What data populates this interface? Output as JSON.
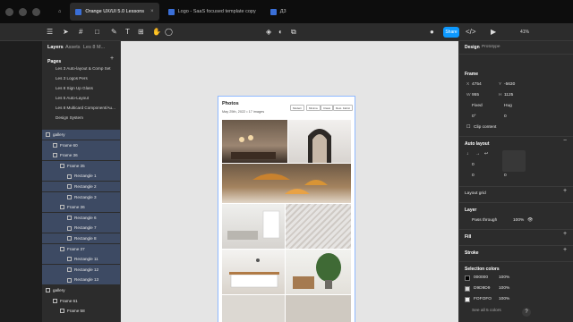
{
  "tabs": [
    {
      "label": "Orange UX/UI 5.0 Lessons",
      "active": true
    },
    {
      "label": "Logo - SaaS focused template copy",
      "active": false
    },
    {
      "label": "Д3",
      "active": false
    }
  ],
  "toolbar": {
    "share_label": "Share",
    "zoom": "41%"
  },
  "left_panel": {
    "tabs": [
      "Layers",
      "Assets",
      "Les 8 M..."
    ],
    "pages_header": "Pages",
    "pages": [
      "Les 3 Auto-layout & Comp Set",
      "Les 3 Logos Pers",
      "Les 8 Sign Up Glass",
      "Les 5 Auto-Layout",
      "Les 8 Multicard Component/Au...",
      "Design System"
    ],
    "layers": [
      {
        "label": "gallery",
        "indent": 0,
        "selected": true
      },
      {
        "label": "Frame 60",
        "indent": 1,
        "selected": true
      },
      {
        "label": "Frame 36",
        "indent": 1,
        "selected": true
      },
      {
        "label": "Frame 35",
        "indent": 2,
        "selected": true
      },
      {
        "label": "Rectangle 1",
        "indent": 3,
        "selected": true
      },
      {
        "label": "Rectangle 2",
        "indent": 3,
        "selected": true
      },
      {
        "label": "Rectangle 3",
        "indent": 3,
        "selected": true
      },
      {
        "label": "Frame 36",
        "indent": 2,
        "selected": true
      },
      {
        "label": "Rectangle 6",
        "indent": 3,
        "selected": true
      },
      {
        "label": "Rectangle 7",
        "indent": 3,
        "selected": true
      },
      {
        "label": "Rectangle 8",
        "indent": 3,
        "selected": true
      },
      {
        "label": "Frame 37",
        "indent": 2,
        "selected": true
      },
      {
        "label": "Rectangle 11",
        "indent": 3,
        "selected": true
      },
      {
        "label": "Rectangle 12",
        "indent": 3,
        "selected": true
      },
      {
        "label": "Rectangle 13",
        "indent": 3,
        "selected": true
      },
      {
        "label": "gallery",
        "indent": 0,
        "selected": false
      },
      {
        "label": "Frame 61",
        "indent": 1,
        "selected": false
      },
      {
        "label": "Frame 58",
        "indent": 2,
        "selected": false
      }
    ]
  },
  "canvas": {
    "frame_title": "Photos",
    "frame_date": "May 25th, 2022 • 17 images",
    "filters": [
      "Modern",
      "Minima",
      "Classi",
      "Rest. Fabric"
    ]
  },
  "right_panel": {
    "tabs": [
      "Design",
      "Prototype"
    ],
    "frame_header": "Frame",
    "x_label": "X",
    "x": "4754",
    "y_label": "Y",
    "y": "-5630",
    "w_label": "W",
    "w": "955",
    "h_label": "H",
    "h": "1125",
    "wmode": "Fixed",
    "hmode": "Hug",
    "rotation": "0°",
    "radius": "0",
    "clip_content": "Clip content",
    "autolayout_header": "Auto layout",
    "gap_x": "0",
    "gap_y": "0",
    "pad": "0",
    "layout_grid": "Layout grid",
    "layer_header": "Layer",
    "pass_through": "Pass through",
    "opacity": "100%",
    "fill_header": "Fill",
    "stroke_header": "Stroke",
    "selection_colors_header": "Selection colors",
    "colors": [
      {
        "hex": "000000",
        "pct": "100%",
        "color": "#000000"
      },
      {
        "hex": "D9D9D9",
        "pct": "100%",
        "color": "#D9D9D9"
      },
      {
        "hex": "FOFOFO",
        "pct": "100%",
        "color": "#F0F0F0"
      }
    ],
    "see_all": "See all 5 colors"
  }
}
